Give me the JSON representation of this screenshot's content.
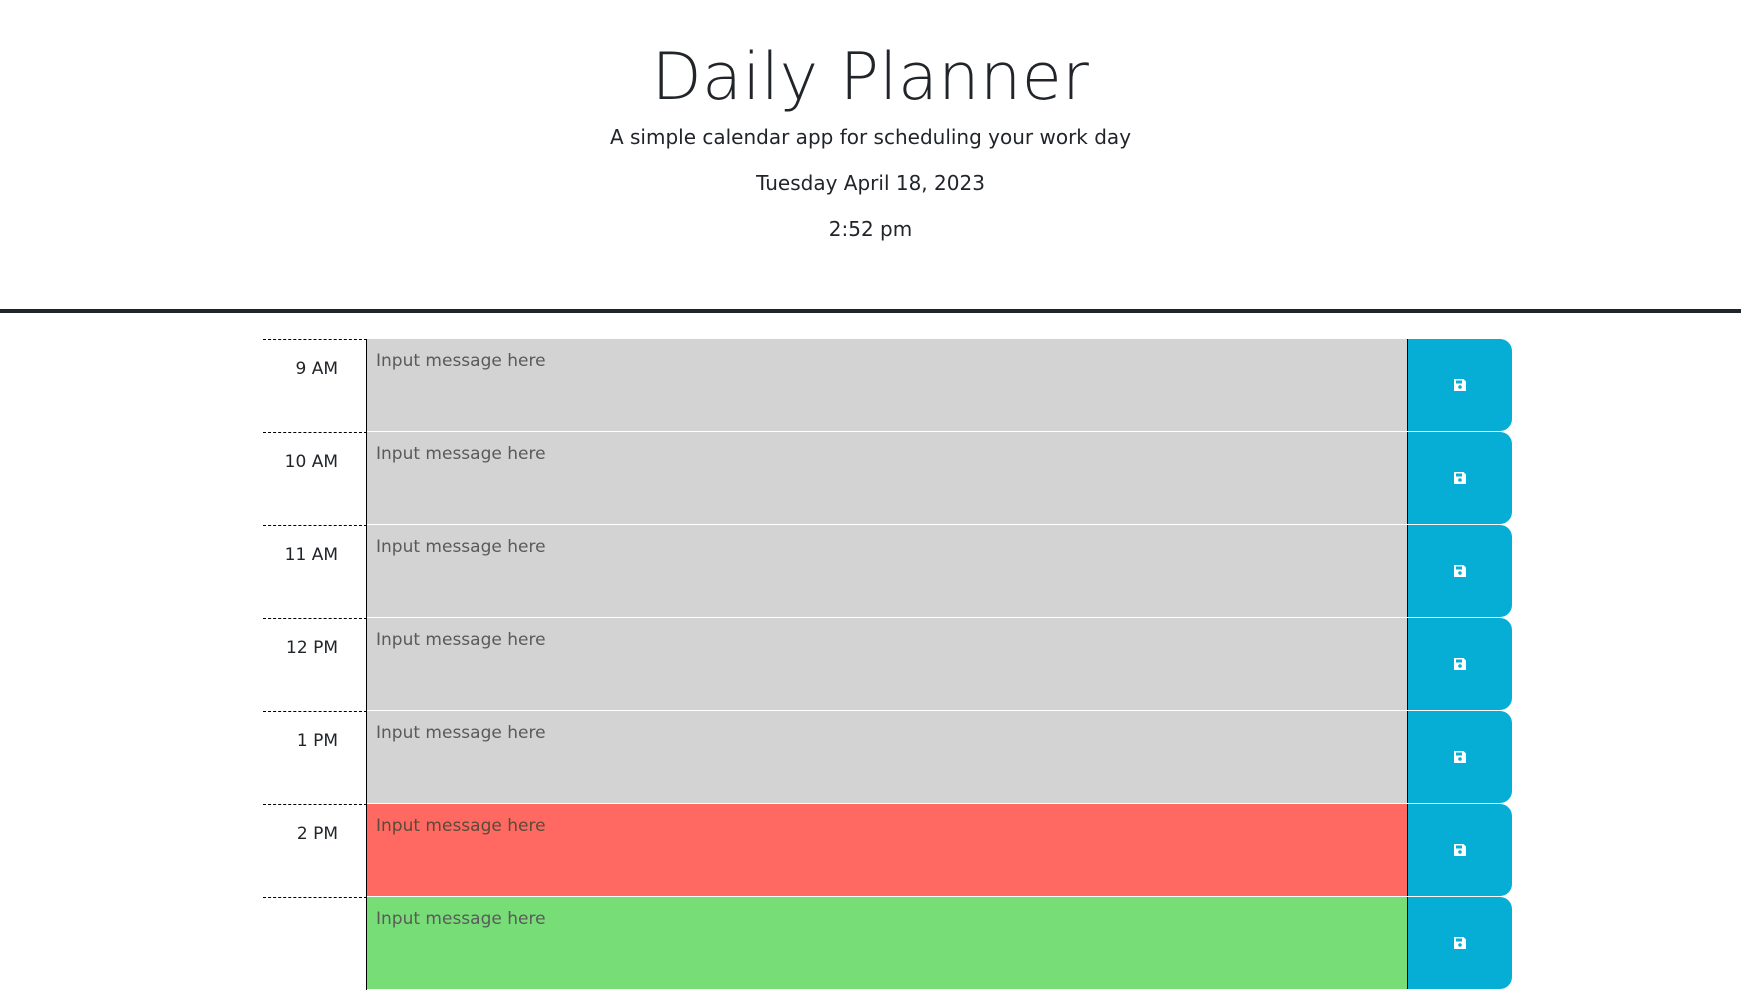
{
  "header": {
    "title": "Daily Planner",
    "subtitle": "A simple calendar app for scheduling your work day",
    "date": "Tuesday April 18, 2023",
    "time": "2:52 pm"
  },
  "schedule": {
    "rows": [
      {
        "hour": "9 AM",
        "placeholder": "Input message here",
        "value": "",
        "status": "past"
      },
      {
        "hour": "10 AM",
        "placeholder": "Input message here",
        "value": "",
        "status": "past"
      },
      {
        "hour": "11 AM",
        "placeholder": "Input message here",
        "value": "",
        "status": "past"
      },
      {
        "hour": "12 PM",
        "placeholder": "Input message here",
        "value": "",
        "status": "past"
      },
      {
        "hour": "1 PM",
        "placeholder": "Input message here",
        "value": "",
        "status": "past"
      },
      {
        "hour": "2 PM",
        "placeholder": "Input message here",
        "value": "",
        "status": "present"
      },
      {
        "hour": "",
        "placeholder": "Input message here",
        "value": "",
        "status": "future"
      }
    ],
    "save_icon": "floppy-disk-icon"
  },
  "colors": {
    "past": "#d3d3d3",
    "present": "#ff6961",
    "future": "#77dd77",
    "save_button": "#06aed5",
    "header_rule": "#212529"
  }
}
